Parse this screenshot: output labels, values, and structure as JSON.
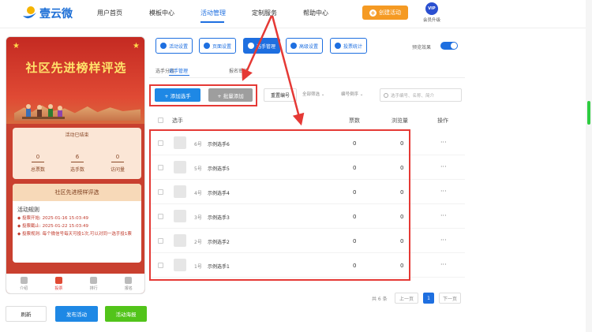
{
  "header": {
    "logo_text": "壹云微",
    "nav": [
      "用户首页",
      "模板中心",
      "活动管理",
      "定制服务",
      "帮助中心"
    ],
    "create_label": "创建活动",
    "vip_badge": "VIP",
    "vip_label": "会员升级"
  },
  "preview": {
    "title": "社区先进榜样评选",
    "status": "活动已结束",
    "stats": [
      {
        "value": "0",
        "label": "总票数"
      },
      {
        "value": "6",
        "label": "选手数"
      },
      {
        "value": "0",
        "label": "访问量"
      }
    ],
    "card_title": "社区先进榜样评选",
    "rules_title": "活动规则",
    "rules": [
      "投票开始: 2025-01-16 15:03:49",
      "投票截止: 2025-01-22 15:03:49",
      "投票规则: 每个微信号每天可投1次,可以对同一选手投1票"
    ],
    "tabs": [
      "介绍",
      "投票",
      "排行",
      "报名"
    ]
  },
  "bottom_buttons": {
    "refresh": "刷新",
    "publish": "发布活动",
    "stats": "活动海报"
  },
  "settings_tabs": [
    "活动设置",
    "页面设置",
    "选手管理",
    "高级设置",
    "投票统计"
  ],
  "preview_label": "预览效果",
  "subtabs": [
    "选手分组",
    "选手管理",
    "报名审核"
  ],
  "toolbar": {
    "add": "+ 添加选手",
    "batch": "+ 批量添加",
    "renumber": "重置编号",
    "filter_all": "全部筛选",
    "filter_sort": "编号倒序",
    "search_placeholder": "选手编号、名称、简介"
  },
  "table": {
    "headers": [
      "选手",
      "票数",
      "浏览量",
      "操作"
    ],
    "rows": [
      {
        "no": "6号",
        "name": "示例选手6",
        "votes": "0",
        "views": "0",
        "action": "···"
      },
      {
        "no": "5号",
        "name": "示例选手5",
        "votes": "0",
        "views": "0",
        "action": "···"
      },
      {
        "no": "4号",
        "name": "示例选手4",
        "votes": "0",
        "views": "0",
        "action": "···"
      },
      {
        "no": "3号",
        "name": "示例选手3",
        "votes": "0",
        "views": "0",
        "action": "···"
      },
      {
        "no": "2号",
        "name": "示例选手2",
        "votes": "0",
        "views": "0",
        "action": "···"
      },
      {
        "no": "1号",
        "name": "示例选手1",
        "votes": "0",
        "views": "0",
        "action": "···"
      }
    ]
  },
  "pager": {
    "total": "共 6 条",
    "prev": "上一页",
    "current": "1",
    "next": "下一页"
  },
  "colors": {
    "primary": "#1e6fe0",
    "orange": "#f59a23",
    "red": "#e53935",
    "green": "#52c41a"
  }
}
